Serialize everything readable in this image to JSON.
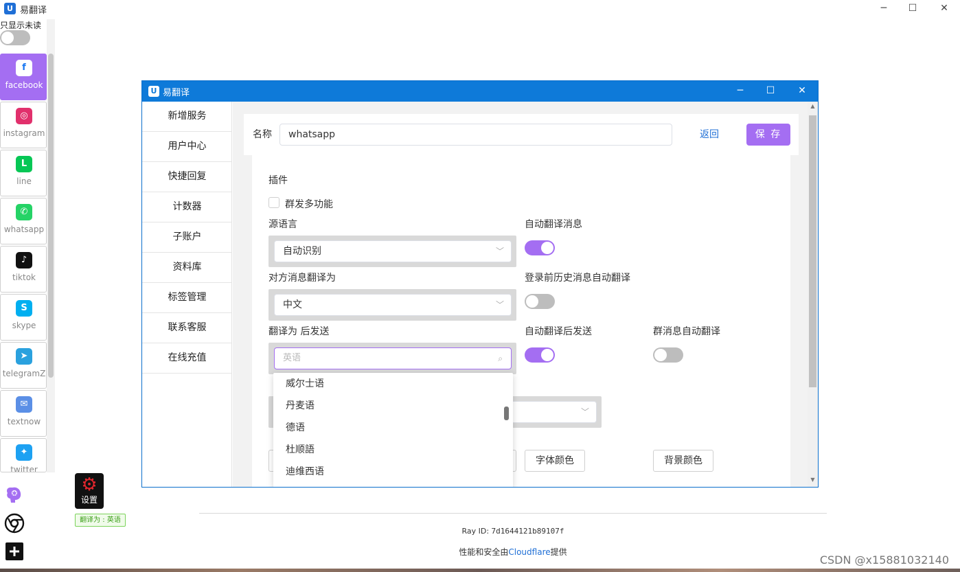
{
  "app": {
    "title": "易翻译",
    "logo_letter": "U"
  },
  "window_controls": {
    "minimize": "─",
    "maximize": "☐",
    "close": "✕"
  },
  "sidebar": {
    "unread_only_label": "只显示未读",
    "unread_only_enabled": false,
    "platforms": [
      {
        "label": "facebook",
        "icon": "facebook-icon",
        "glyph": "f",
        "color": "#1877f2",
        "active": true
      },
      {
        "label": "instagram",
        "icon": "instagram-icon",
        "glyph": "◎",
        "color": "#e1306c",
        "active": false
      },
      {
        "label": "line",
        "icon": "line-icon",
        "glyph": "L",
        "color": "#06c755",
        "active": false
      },
      {
        "label": "whatsapp",
        "icon": "whatsapp-icon",
        "glyph": "✆",
        "color": "#25d366",
        "active": false
      },
      {
        "label": "tiktok",
        "icon": "tiktok-icon",
        "glyph": "♪",
        "color": "#111111",
        "active": false
      },
      {
        "label": "skype",
        "icon": "skype-icon",
        "glyph": "S",
        "color": "#00aff0",
        "active": false
      },
      {
        "label": "telegramZ",
        "icon": "telegram-icon",
        "glyph": "➤",
        "color": "#2aa1de",
        "active": false
      },
      {
        "label": "textnow",
        "icon": "textnow-icon",
        "glyph": "✉",
        "color": "#5b8fe6",
        "active": false
      },
      {
        "label": "twitter",
        "icon": "twitter-icon",
        "glyph": "✦",
        "color": "#1da1f2",
        "active": false
      }
    ],
    "tools": [
      "brain-icon",
      "chrome-icon",
      "add-icon"
    ]
  },
  "settings_button": {
    "label": "设置",
    "icon": "gear-icon"
  },
  "translate_badge": "翻译为 : 英语",
  "background_page": {
    "ray_id_label": "Ray ID: ",
    "ray_id_value": "7d1644121b89107f",
    "perf_prefix": "性能和安全由",
    "perf_link": "Cloudflare",
    "perf_suffix": "提供",
    "watermark": "CSDN @x15881032140"
  },
  "dialog": {
    "title": "易翻译",
    "menu": [
      "新增服务",
      "用户中心",
      "快捷回复",
      "计数器",
      "子账户",
      "资料库",
      "标签管理",
      "联系客服",
      "在线充值"
    ],
    "name_label": "名称",
    "name_value": "whatsapp",
    "back_label": "返回",
    "save_label": "保 存",
    "plugins_label": "插件",
    "group_send_label": "群发多功能",
    "group_send_checked": false,
    "source_lang_label": "源语言",
    "source_lang_value": "自动识别",
    "auto_translate_msg_label": "自动翻译消息",
    "auto_translate_msg_on": true,
    "peer_translate_label": "对方消息翻译为",
    "peer_translate_value": "中文",
    "history_translate_label": "登录前历史消息自动翻译",
    "history_translate_on": false,
    "send_translate_label": "翻译为 后发送",
    "send_translate_placeholder": "英语",
    "auto_send_label": "自动翻译后发送",
    "auto_send_on": true,
    "group_auto_label": "群消息自动翻译",
    "group_auto_on": false,
    "font_color_label": "字体颜色",
    "bg_color_label": "背景颜色",
    "dropdown_options": [
      "威尔士语",
      "丹麦语",
      "德语",
      "杜顺語",
      "迪维西语"
    ]
  }
}
